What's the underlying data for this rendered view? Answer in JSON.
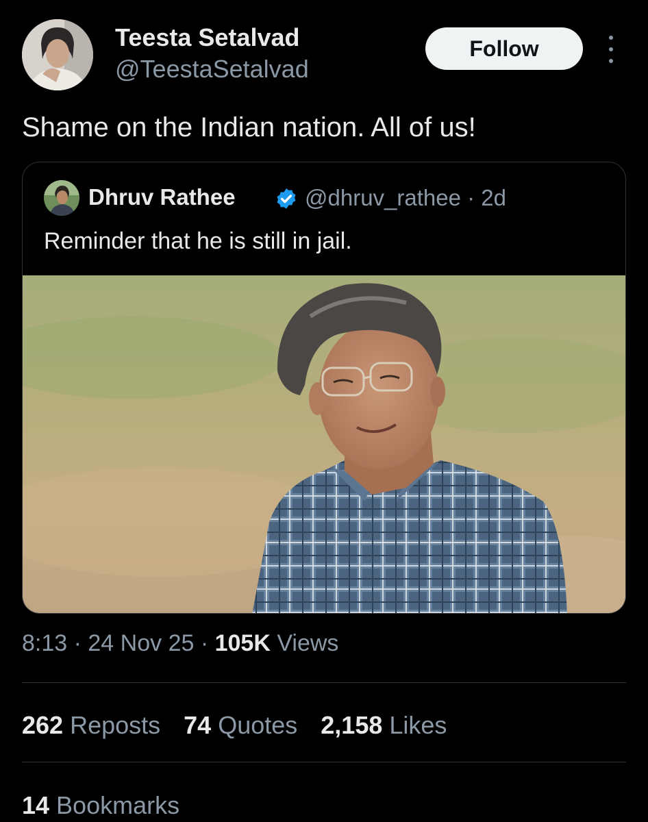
{
  "author": {
    "name": "Teesta Setalvad",
    "handle": "@TeestaSetalvad"
  },
  "follow_label": "Follow",
  "tweet_text": "Shame on the Indian nation. All of us!",
  "quoted": {
    "name": "Dhruv Rathee",
    "handle_time": "@dhruv_rathee · 2d",
    "text": "Reminder that he is still in jail."
  },
  "meta": {
    "time_date": "8:13 · 24 Nov 25 · ",
    "views_count": "105K",
    "views_label": " Views"
  },
  "stats": {
    "reposts_count": "262",
    "reposts_label": " Reposts",
    "quotes_count": "74",
    "quotes_label": " Quotes",
    "likes_count": "2,158",
    "likes_label": " Likes",
    "bookmarks_count": "14",
    "bookmarks_label": " Bookmarks"
  },
  "icons": {
    "more": "more-vertical-icon",
    "verified": "verified-badge-icon"
  },
  "colors": {
    "background": "#000000",
    "text_primary": "#e7e9ea",
    "text_secondary": "#8b98a5",
    "border": "#2f3336",
    "verified": "#1d9bf0"
  }
}
